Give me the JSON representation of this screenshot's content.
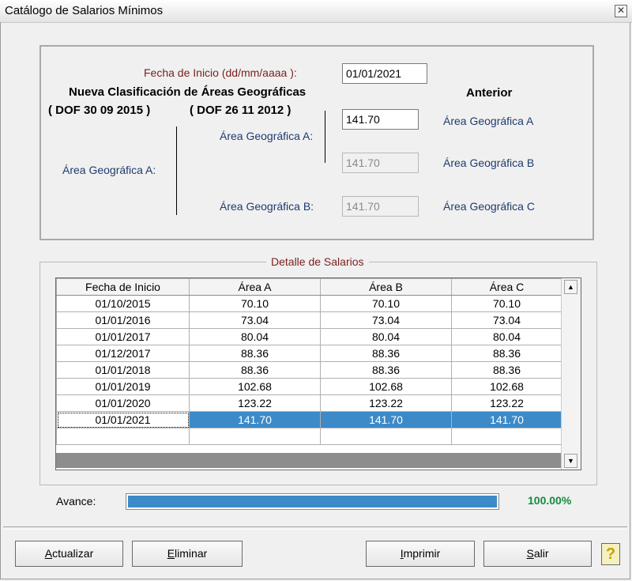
{
  "window": {
    "title": "Catálogo de Salarios Mínimos"
  },
  "form": {
    "fecha_label": "Fecha de Inicio (dd/mm/aaaa ):",
    "fecha_value": "01/01/2021",
    "nueva_clasificacion": "Nueva Clasificación de Áreas Geográficas",
    "dof_2015": "( DOF 30 09 2015 )",
    "dof_2012": "( DOF 26 11 2012 )",
    "anterior": "Anterior",
    "area_a_label_left": "Área Geográfica A:",
    "area_a_label_mid": "Área Geográfica A:",
    "area_b_label_mid": "Área Geográfica B:",
    "value_a": "141.70",
    "value_b": "141.70",
    "value_c": "141.70",
    "anterior_a": "Área Geográfica A",
    "anterior_b": "Área Geográfica B",
    "anterior_c": "Área Geográfica C"
  },
  "detalle": {
    "title": "Detalle de Salarios",
    "columns": [
      "Fecha de Inicio",
      "Área A",
      "Área B",
      "Área C"
    ],
    "rows": [
      [
        "01/10/2015",
        "70.10",
        "70.10",
        "70.10"
      ],
      [
        "01/01/2016",
        "73.04",
        "73.04",
        "73.04"
      ],
      [
        "01/01/2017",
        "80.04",
        "80.04",
        "80.04"
      ],
      [
        "01/12/2017",
        "88.36",
        "88.36",
        "88.36"
      ],
      [
        "01/01/2018",
        "88.36",
        "88.36",
        "88.36"
      ],
      [
        "01/01/2019",
        "102.68",
        "102.68",
        "102.68"
      ],
      [
        "01/01/2020",
        "123.22",
        "123.22",
        "123.22"
      ],
      [
        "01/01/2021",
        "141.70",
        "141.70",
        "141.70"
      ]
    ],
    "selected_row": 7
  },
  "progress": {
    "label": "Avance:",
    "percent_text": "100.00%",
    "fraction": 1.0,
    "color": "#3d8ac8"
  },
  "buttons": {
    "actualizar": {
      "hot": "A",
      "rest": "ctualizar"
    },
    "eliminar": {
      "hot": "E",
      "rest": "liminar"
    },
    "imprimir": {
      "hot": "I",
      "rest": "mprimir"
    },
    "salir": {
      "hot": "S",
      "rest": "alir"
    },
    "help_icon": "question-mark-icon"
  }
}
